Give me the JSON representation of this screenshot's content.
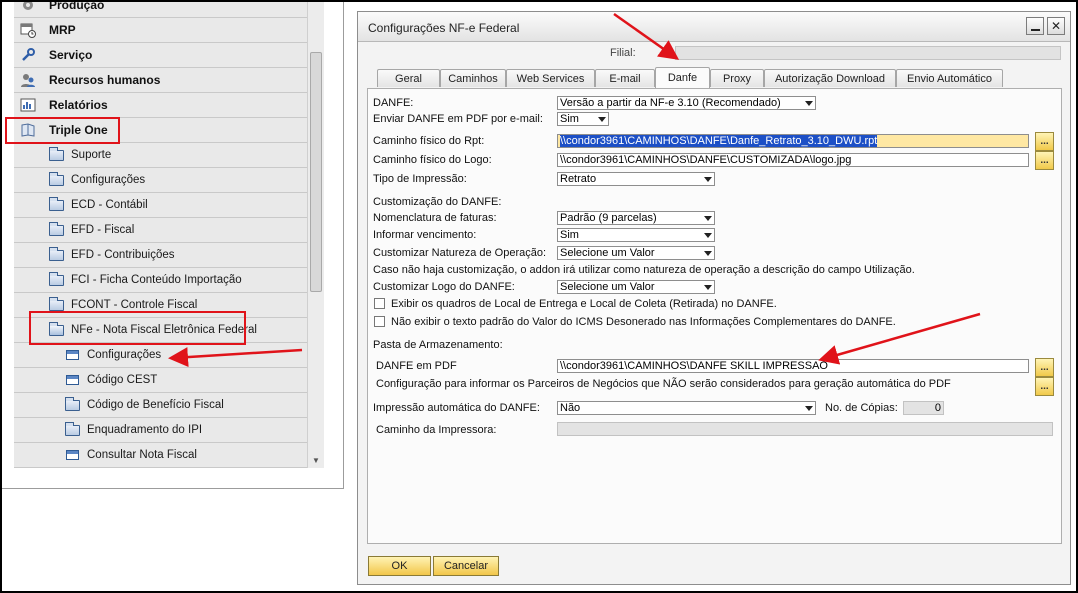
{
  "menu": {
    "top_items": [
      {
        "label": "Produção",
        "icon": "gear-icon"
      },
      {
        "label": "MRP",
        "icon": "calendar-clock-icon"
      },
      {
        "label": "Serviço",
        "icon": "wrench-icon"
      },
      {
        "label": "Recursos humanos",
        "icon": "people-icon"
      },
      {
        "label": "Relatórios",
        "icon": "bar-chart-icon"
      },
      {
        "label": "Triple One",
        "icon": "book-icon"
      }
    ],
    "sub_items": [
      {
        "label": "Suporte",
        "icon": "folder-icon"
      },
      {
        "label": "Configurações",
        "icon": "folder-icon"
      },
      {
        "label": "ECD - Contábil",
        "icon": "folder-icon"
      },
      {
        "label": "EFD - Fiscal",
        "icon": "folder-icon"
      },
      {
        "label": "EFD - Contribuições",
        "icon": "folder-icon"
      },
      {
        "label": "FCI - Ficha Conteúdo Importação",
        "icon": "folder-icon"
      },
      {
        "label": "FCONT - Controle Fiscal",
        "icon": "folder-icon"
      },
      {
        "label": "NFe - Nota Fiscal Eletrônica Federal",
        "icon": "folder-open-icon"
      }
    ],
    "nfe_items": [
      {
        "label": "Configurações",
        "icon": "form-icon"
      },
      {
        "label": "Código CEST",
        "icon": "form-icon"
      },
      {
        "label": "Código de Benefício Fiscal",
        "icon": "folder-icon"
      },
      {
        "label": "Enquadramento do IPI",
        "icon": "folder-icon"
      },
      {
        "label": "Consultar Nota Fiscal",
        "icon": "form-icon"
      }
    ]
  },
  "dialog": {
    "title": "Configurações NF-e Federal",
    "filial_label": "Filial:",
    "filial_value": "",
    "tabs": [
      "Geral",
      "Caminhos",
      "Web Services",
      "E-mail",
      "Danfe",
      "Proxy",
      "Autorização Download",
      "Envio Automático"
    ],
    "active_tab": "Danfe",
    "danfe": {
      "danfe_label": "DANFE:",
      "danfe_value": "Versão a partir da NF-e 3.10 (Recomendado)",
      "enviar_pdf_label": "Enviar DANFE em PDF por e-mail:",
      "enviar_pdf_value": "Sim",
      "caminho_rpt_label": "Caminho físico do Rpt:",
      "caminho_rpt_value": "\\\\condor3961\\CAMINHOS\\DANFE\\Danfe_Retrato_3.10_DWU.rpt",
      "caminho_logo_label": "Caminho físico do Logo:",
      "caminho_logo_value": "\\\\condor3961\\CAMINHOS\\DANFE\\CUSTOMIZADA\\logo.jpg",
      "tipo_impressao_label": "Tipo de Impressão:",
      "tipo_impressao_value": "Retrato",
      "customizacao_header": "Customização do DANFE:",
      "nomenclatura_label": "Nomenclatura de faturas:",
      "nomenclatura_value": "Padrão (9 parcelas)",
      "informar_venc_label": "Informar vencimento:",
      "informar_venc_value": "Sim",
      "natureza_label": "Customizar Natureza de Operação:",
      "natureza_value": "Selecione um Valor",
      "natureza_info": "Caso não haja customização, o addon irá utilizar como natureza de operação a descrição do campo Utilização.",
      "logo_custom_label": "Customizar Logo do DANFE:",
      "logo_custom_value": "Selecione um Valor",
      "chk_quadros_label": "Exibir os quadros de Local de Entrega e Local de Coleta (Retirada) no DANFE.",
      "chk_quadros_checked": false,
      "chk_icms_label": "Não exibir o texto padrão do Valor do ICMS Desonerado nas Informações Complementares do DANFE.",
      "chk_icms_checked": false,
      "pasta_header": "Pasta de Armazenamento:",
      "danfe_pdf_label": "DANFE em PDF",
      "danfe_pdf_value": "\\\\condor3961\\CAMINHOS\\DANFE SKILL IMPRESSAO",
      "parceiros_label": "Configuração para informar os Parceiros de Negócios que NÃO serão considerados para geração automática do PDF",
      "impressao_auto_label": "Impressão automática do DANFE:",
      "impressao_auto_value": "Não",
      "copias_label": "No. de Cópias:",
      "copias_value": "0",
      "caminho_impressora_label": "Caminho da Impressora:",
      "caminho_impressora_value": "",
      "browse_label": "..."
    },
    "ok_label": "OK",
    "cancel_label": "Cancelar"
  },
  "colors": {
    "annotation_red": "#e0131a",
    "button_yellow": "#f2c64a",
    "highlight_field": "#ffe8a3",
    "selection_blue": "#1c4fc6"
  }
}
